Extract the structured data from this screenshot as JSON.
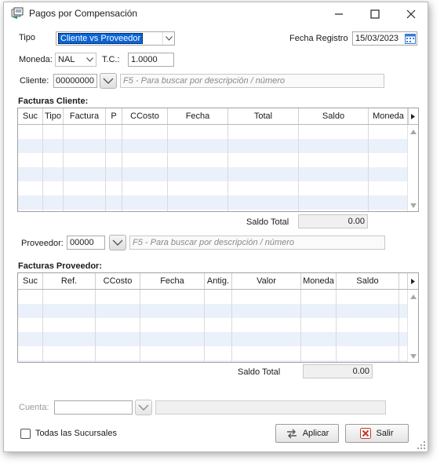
{
  "window": {
    "title": "Pagos por Compensación",
    "controls": {
      "minimize": "—",
      "maximize": "☐",
      "close": "✕"
    }
  },
  "tipo": {
    "label": "Tipo",
    "value": "Cliente vs Proveedor"
  },
  "fecha_registro": {
    "label": "Fecha Registro",
    "value": "15/03/2023"
  },
  "moneda": {
    "label": "Moneda:",
    "value": "NAL"
  },
  "tc": {
    "label": "T.C.:",
    "value": "1.0000"
  },
  "cliente": {
    "label": "Cliente:",
    "number": "00000000",
    "search_placeholder": "F5 - Para buscar por descripción / número"
  },
  "facturas_cliente": {
    "title": "Facturas Cliente:",
    "columns": [
      "Suc",
      "Tipo",
      "Factura",
      "P",
      "CCosto",
      "Fecha",
      "Total",
      "Saldo",
      "Moneda"
    ],
    "rows": [],
    "saldo_total_label": "Saldo Total",
    "saldo_total": "0.00"
  },
  "proveedor": {
    "label": "Proveedor:",
    "number": "00000",
    "search_placeholder": "F5 - Para buscar por descripción / número"
  },
  "facturas_proveedor": {
    "title": "Facturas Proveedor:",
    "columns": [
      "Suc",
      "Ref.",
      "CCosto",
      "Fecha",
      "Antig.",
      "Valor",
      "Moneda",
      "Saldo"
    ],
    "rows": [],
    "saldo_total_label": "Saldo Total",
    "saldo_total": "0.00"
  },
  "cuenta": {
    "label": "Cuenta:",
    "value": "",
    "description": ""
  },
  "todas_sucursales": {
    "label": "Todas las Sucursales",
    "checked": false
  },
  "buttons": {
    "aplicar": "Aplicar",
    "salir": "Salir"
  },
  "colors": {
    "selection": "#0a64d6",
    "grid_alt_row": "#eaf1fb",
    "close_icon": "#c0392b"
  }
}
